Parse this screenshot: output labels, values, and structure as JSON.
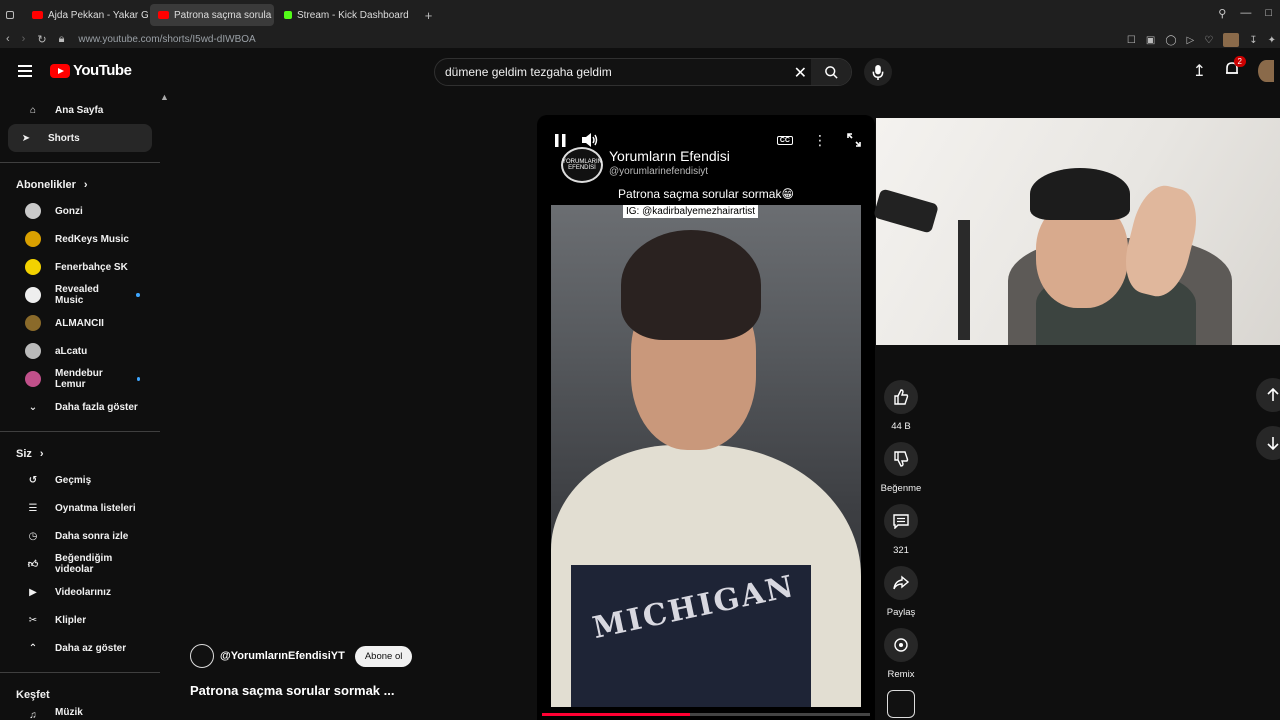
{
  "browser": {
    "tabs": [
      {
        "label": "Ajda Pekkan - Yakar Geçe",
        "icon": "youtube-favicon",
        "active": false
      },
      {
        "label": "Patrona saçma sorula",
        "icon": "youtube-favicon",
        "active": true
      },
      {
        "label": "Stream - Kick Dashboard",
        "icon": "kick-favicon",
        "active": false
      }
    ],
    "new_tab": "+",
    "url": "www.youtube.com/shorts/I5wd-dIWBOA"
  },
  "header": {
    "logo_text": "YouTube",
    "search_value": "dümene geldim tezgaha geldim",
    "notifications_count": "2"
  },
  "sidebar": {
    "main": [
      {
        "label": "Ana Sayfa",
        "icon": "home-icon"
      },
      {
        "label": "Shorts",
        "icon": "shorts-icon",
        "selected": true
      }
    ],
    "subs_title": "Abonelikler",
    "subs": [
      {
        "label": "Gonzi",
        "color": "#c9c9c9",
        "dot": false
      },
      {
        "label": "RedKeys Music",
        "color": "#d9a000",
        "dot": false
      },
      {
        "label": "Fenerbahçe SK",
        "color": "#f2d200",
        "dot": false
      },
      {
        "label": "Revealed Music",
        "color": "#eeeeee",
        "dot": true
      },
      {
        "label": "ALMANCII",
        "color": "#8a6a2a",
        "dot": false
      },
      {
        "label": "aLcatu",
        "color": "#bbbbbb",
        "dot": false
      },
      {
        "label": "Mendebur Lemur",
        "color": "#c0508a",
        "dot": true
      }
    ],
    "show_more": "Daha fazla göster",
    "you_title": "Siz",
    "you": [
      {
        "label": "Geçmiş",
        "icon": "history-icon"
      },
      {
        "label": "Oynatma listeleri",
        "icon": "playlists-icon"
      },
      {
        "label": "Daha sonra izle",
        "icon": "clock-icon"
      },
      {
        "label": "Beğendiğim videolar",
        "icon": "thumb-up-icon"
      },
      {
        "label": "Videolarınız",
        "icon": "video-icon"
      },
      {
        "label": "Klipler",
        "icon": "scissors-icon"
      },
      {
        "label": "Daha az göster",
        "icon": "chevron-up-icon"
      }
    ],
    "explore_title": "Keşfet",
    "explore_first": "Müzik"
  },
  "video": {
    "channel_name": "Yorumların Efendisi",
    "channel_handle": "@yorumlarinefendisiyt",
    "caption": "Patrona saçma sorular sormak😁",
    "ig_tag": "IG: @kadirbalyemezhairartist",
    "logo_text": "YORUMLARIN EFENDİSİ",
    "jersey_text": "MICHIGAN",
    "progress": 0.45,
    "cc": "CC"
  },
  "actions": {
    "like_count": "44 B",
    "dislike_label": "Beğenme",
    "comment_count": "321",
    "share_label": "Paylaş",
    "remix_label": "Remix"
  },
  "bottom": {
    "handle": "@YorumlarınEfendisiYT",
    "subscribe": "Abone ol",
    "title": "Patrona saçma sorular sormak ..."
  }
}
